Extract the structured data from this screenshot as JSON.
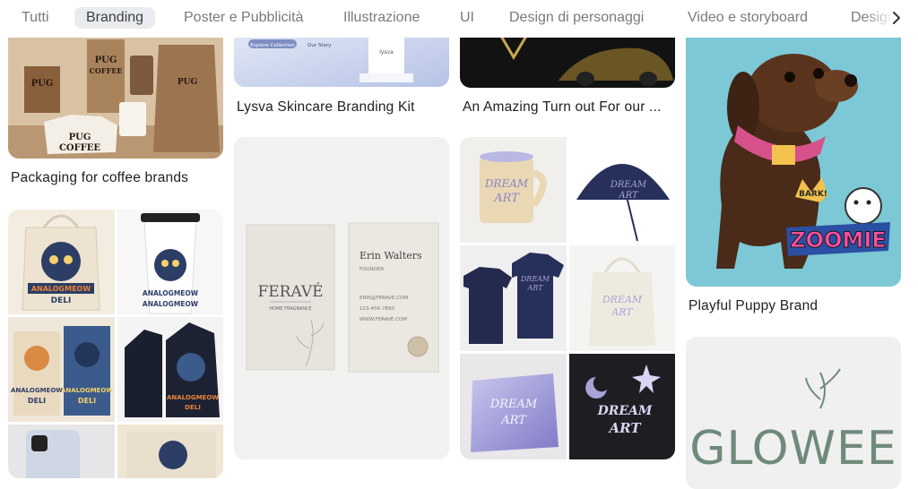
{
  "tabs": [
    {
      "label": "Tutti"
    },
    {
      "label": "Branding",
      "active": true
    },
    {
      "label": "Poster e Pubblicità"
    },
    {
      "label": "Illustrazione"
    },
    {
      "label": "UI"
    },
    {
      "label": "Design di personaggi"
    },
    {
      "label": "Video e storyboard"
    },
    {
      "label": "Design"
    }
  ],
  "cards": {
    "coffee": {
      "title": "Packaging for coffee brands",
      "brand_line1": "PUG",
      "brand_line2": "COFFEE"
    },
    "lysva": {
      "title": "Lysva Skincare Branding Kit",
      "chip": "Explore Collection",
      "link": "Our Story",
      "product": "lysva"
    },
    "amazing": {
      "title": "An Amazing Turn out For our ..."
    },
    "puppy": {
      "title": "Playful Puppy Brand",
      "sticker_bark": "BARK!",
      "sticker_main": "ZOOMIE"
    },
    "analog": {
      "brand_line1": "ANALOGMEOW",
      "brand_line2": "DELI"
    },
    "ferave": {
      "brand": "FERAVÉ",
      "tagline": "HOME FRAGRANCE",
      "person": "Erin Walters",
      "role": "FOUNDER",
      "email": "ERIN@FERAVE.COM",
      "phone": "123-456-7890",
      "web": "WWW.FERAVE.COM"
    },
    "dream": {
      "line1": "DREAM",
      "line2": "ART"
    },
    "glowee": {
      "brand": "GLOWEE"
    }
  },
  "colors": {
    "tab_active_bg": "#e9ebee",
    "tab_text": "#7a7a7a",
    "puppy_bg": "#7cc8d6",
    "dream_navy": "#27305a",
    "dream_lilac": "#a7a4d8",
    "glowee_green": "#6f8a7a"
  }
}
